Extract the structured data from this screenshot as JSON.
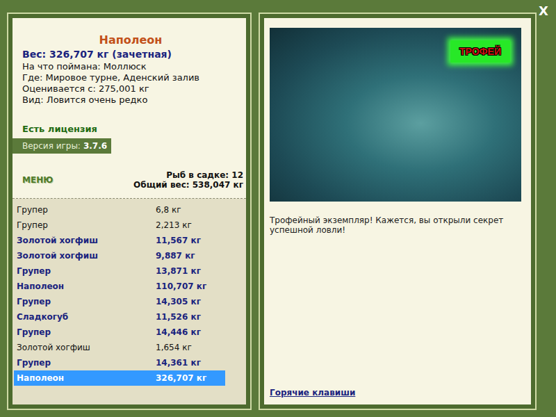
{
  "close": "X",
  "fish": {
    "title": "Наполеон",
    "weight": "Вес: 326,707 кг (зачетная)",
    "details": [
      "На что поймана: Моллюск",
      "Где: Мировое турне, Аденский залив",
      "Оценивается с: 275,001 кг",
      "Вид: Ловится очень редко"
    ]
  },
  "license": "Есть лицензия",
  "version": {
    "label": "Версия игры:",
    "value": "3.7.6"
  },
  "menu": "МЕНЮ",
  "stats": [
    "Рыб в садке: 12",
    "Общий вес: 538,047 кг"
  ],
  "catch": [
    {
      "name": "Групер",
      "weight": "6,8 кг",
      "trophy": false,
      "selected": false
    },
    {
      "name": "Групер",
      "weight": "2,213 кг",
      "trophy": false,
      "selected": false
    },
    {
      "name": "Золотой хогфиш",
      "weight": "11,567 кг",
      "trophy": true,
      "selected": false
    },
    {
      "name": "Золотой хогфиш",
      "weight": "9,887 кг",
      "trophy": true,
      "selected": false
    },
    {
      "name": "Групер",
      "weight": "13,871 кг",
      "trophy": true,
      "selected": false
    },
    {
      "name": "Наполеон",
      "weight": "110,707 кг",
      "trophy": true,
      "selected": false
    },
    {
      "name": "Групер",
      "weight": "14,305 кг",
      "trophy": true,
      "selected": false
    },
    {
      "name": "Сладкогуб",
      "weight": "11,526 кг",
      "trophy": true,
      "selected": false
    },
    {
      "name": "Групер",
      "weight": "14,446 кг",
      "trophy": true,
      "selected": false
    },
    {
      "name": "Золотой хогфиш",
      "weight": "1,654 кг",
      "trophy": false,
      "selected": false
    },
    {
      "name": "Групер",
      "weight": "14,361 кг",
      "trophy": true,
      "selected": false
    },
    {
      "name": "Наполеон",
      "weight": "326,707 кг",
      "trophy": true,
      "selected": true
    }
  ],
  "photo": {
    "badge": "ТРОФЕЙ"
  },
  "caption": "Трофейный экземпляр! Кажется, вы открыли секрет успешной ловли!",
  "hotkeys": "Горячие клавиши"
}
